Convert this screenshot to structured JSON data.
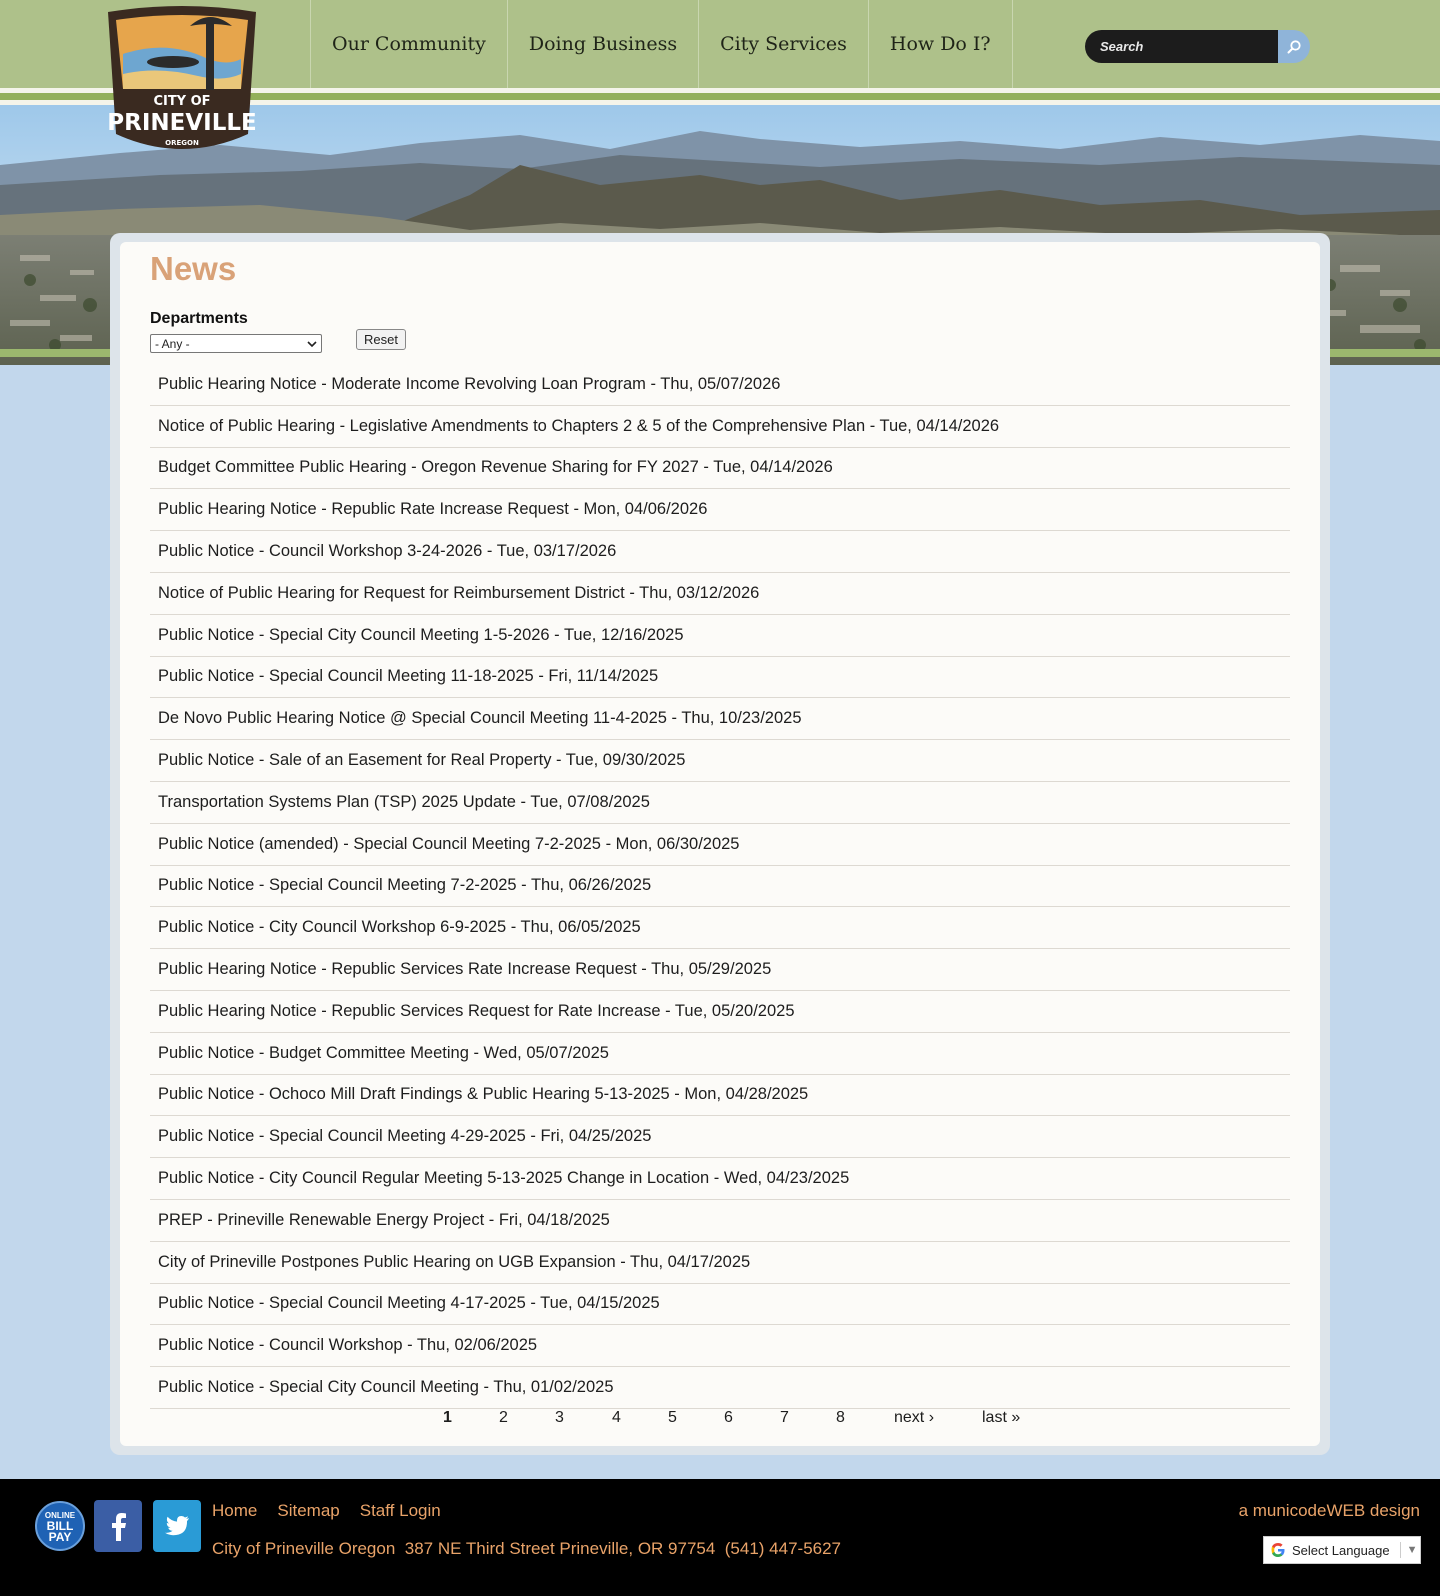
{
  "header": {
    "logo_text": {
      "line1": "CITY OF",
      "line2": "PRINEVILLE",
      "line3": "OREGON"
    },
    "nav": [
      "Our Community",
      "Doing Business",
      "City Services",
      "How Do I?"
    ],
    "search_placeholder": "Search",
    "search_icon": "magnifier-icon"
  },
  "colors": {
    "topbar": "#aec18a",
    "accent_green": "#93b05b",
    "title_orange": "#d9a278",
    "footer_link": "#e9a369",
    "page_bg": "#c2d7ec"
  },
  "main": {
    "title": "News",
    "filter": {
      "label": "Departments",
      "selected": "- Any -",
      "reset_label": "Reset"
    },
    "items": [
      "Public Hearing Notice - Moderate Income Revolving Loan Program - Thu, 05/07/2026",
      "Notice of Public Hearing - Legislative Amendments to Chapters 2 & 5 of the Comprehensive Plan - Tue, 04/14/2026",
      "Budget Committee Public Hearing - Oregon Revenue Sharing for FY 2027 - Tue, 04/14/2026",
      "Public Hearing Notice - Republic Rate Increase Request - Mon, 04/06/2026",
      "Public Notice - Council Workshop 3-24-2026 - Tue, 03/17/2026",
      "Notice of Public Hearing for Request for Reimbursement District - Thu, 03/12/2026",
      "Public Notice - Special City Council Meeting 1-5-2026 - Tue, 12/16/2025",
      "Public Notice - Special Council Meeting 11-18-2025 - Fri, 11/14/2025",
      "De Novo Public Hearing Notice @ Special Council Meeting 11-4-2025 - Thu, 10/23/2025",
      "Public Notice - Sale of an Easement for Real Property - Tue, 09/30/2025",
      "Transportation Systems Plan (TSP) 2025 Update - Tue, 07/08/2025",
      "Public Notice (amended) - Special Council Meeting 7-2-2025 - Mon, 06/30/2025",
      "Public Notice - Special Council Meeting 7-2-2025 - Thu, 06/26/2025",
      "Public Notice - City Council Workshop 6-9-2025 - Thu, 06/05/2025",
      "Public Hearing Notice - Republic Services Rate Increase Request - Thu, 05/29/2025",
      "Public Hearing Notice - Republic Services Request for Rate Increase - Tue, 05/20/2025",
      "Public Notice - Budget Committee Meeting - Wed, 05/07/2025",
      "Public Notice - Ochoco Mill Draft Findings & Public Hearing 5-13-2025 - Mon, 04/28/2025",
      "Public Notice - Special Council Meeting 4-29-2025 - Fri, 04/25/2025",
      "Public Notice - City Council Regular Meeting 5-13-2025 Change in Location - Wed, 04/23/2025",
      "PREP - Prineville Renewable Energy Project - Fri, 04/18/2025",
      "City of Prineville Postpones Public Hearing on UGB Expansion - Thu, 04/17/2025",
      "Public Notice - Special Council Meeting 4-17-2025 - Tue, 04/15/2025",
      "Public Notice - Council Workshop - Thu, 02/06/2025",
      "Public Notice - Special City Council Meeting - Thu, 01/02/2025"
    ],
    "pager": {
      "current": "1",
      "pages": [
        "1",
        "2",
        "3",
        "4",
        "5",
        "6",
        "7",
        "8"
      ],
      "next": "next ›",
      "last": "last »"
    }
  },
  "footer": {
    "bill_pay": {
      "line1": "ONLINE",
      "line2": "BILL",
      "line3": "PAY"
    },
    "facebook_icon": "facebook-icon",
    "twitter_icon": "twitter-icon",
    "links": [
      "Home",
      "Sitemap",
      "Staff Login"
    ],
    "address": "City of Prineville Oregon  387 NE Third Street Prineville, OR 97754  (541) 447-5627",
    "credit": "a municodeWEB design",
    "language": "Select Language"
  }
}
